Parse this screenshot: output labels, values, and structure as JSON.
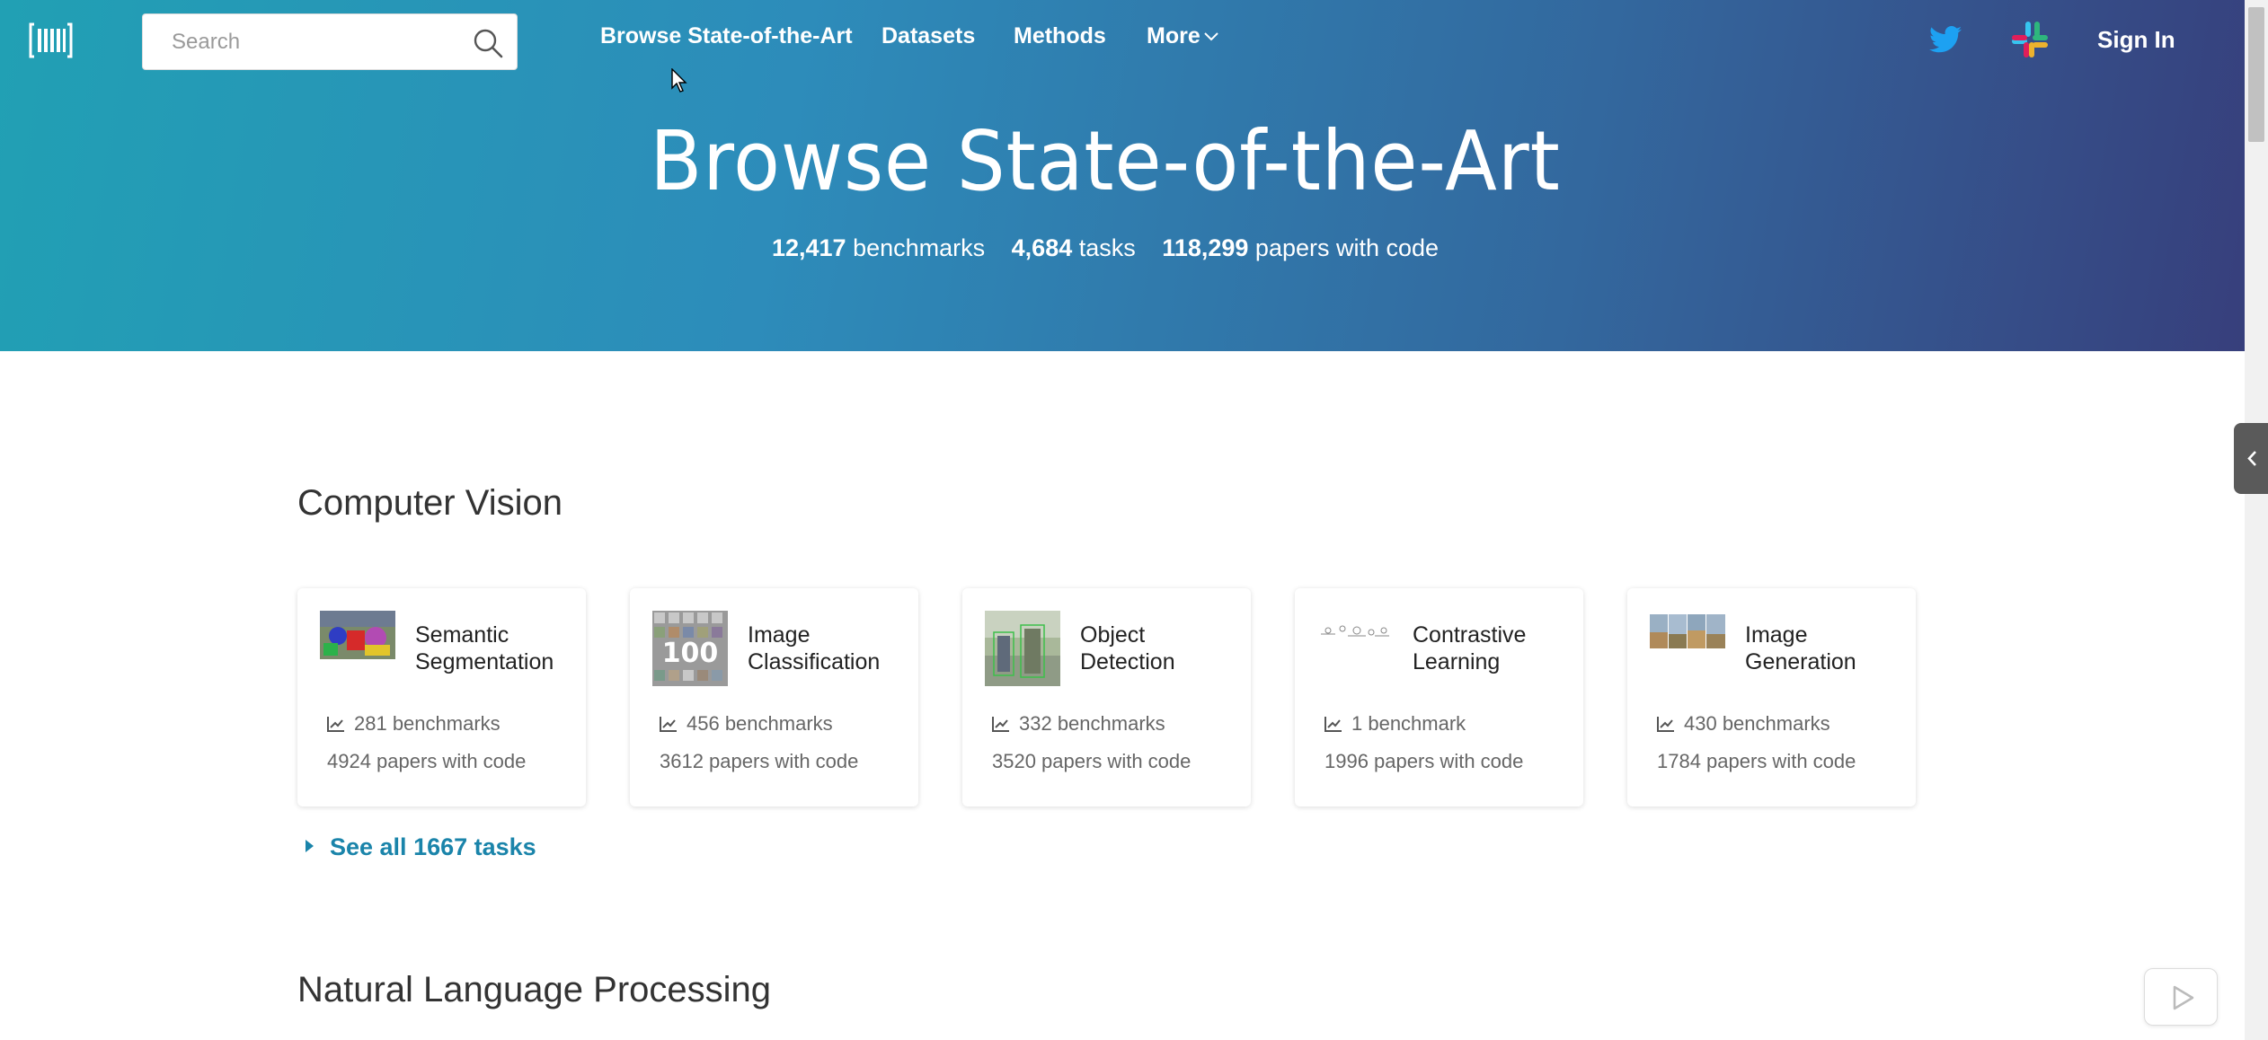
{
  "header": {
    "search": {
      "placeholder": "Search",
      "value": ""
    },
    "nav": [
      {
        "label": "Browse State-of-the-Art"
      },
      {
        "label": "Datasets"
      },
      {
        "label": "Methods"
      },
      {
        "label": "More"
      }
    ],
    "sign_in": "Sign In"
  },
  "hero": {
    "title": "Browse State-of-the-Art",
    "stats": [
      {
        "value": "12,417",
        "label": "benchmarks"
      },
      {
        "value": "4,684",
        "label": "tasks"
      },
      {
        "value": "118,299",
        "label": "papers with code"
      }
    ]
  },
  "sections": [
    {
      "title": "Computer Vision",
      "tasks": [
        {
          "title": "Semantic Segmentation",
          "benchmarks": "281 benchmarks",
          "papers": "4924 papers with code"
        },
        {
          "title": "Image Classification",
          "benchmarks": "456 benchmarks",
          "papers": "3612 papers with code"
        },
        {
          "title": "Object Detection",
          "benchmarks": "332 benchmarks",
          "papers": "3520 papers with code"
        },
        {
          "title": "Contrastive Learning",
          "benchmarks": "1 benchmark",
          "papers": "1996 papers with code"
        },
        {
          "title": "Image Generation",
          "benchmarks": "430 benchmarks",
          "papers": "1784 papers with code"
        }
      ],
      "see_all": "See all 1667 tasks"
    },
    {
      "title": "Natural Language Processing"
    }
  ],
  "colors": {
    "hero_gradient_start": "#21a0b4",
    "hero_gradient_end": "#373f7c",
    "link": "#1a84aa",
    "twitter": "#1da1f2"
  }
}
